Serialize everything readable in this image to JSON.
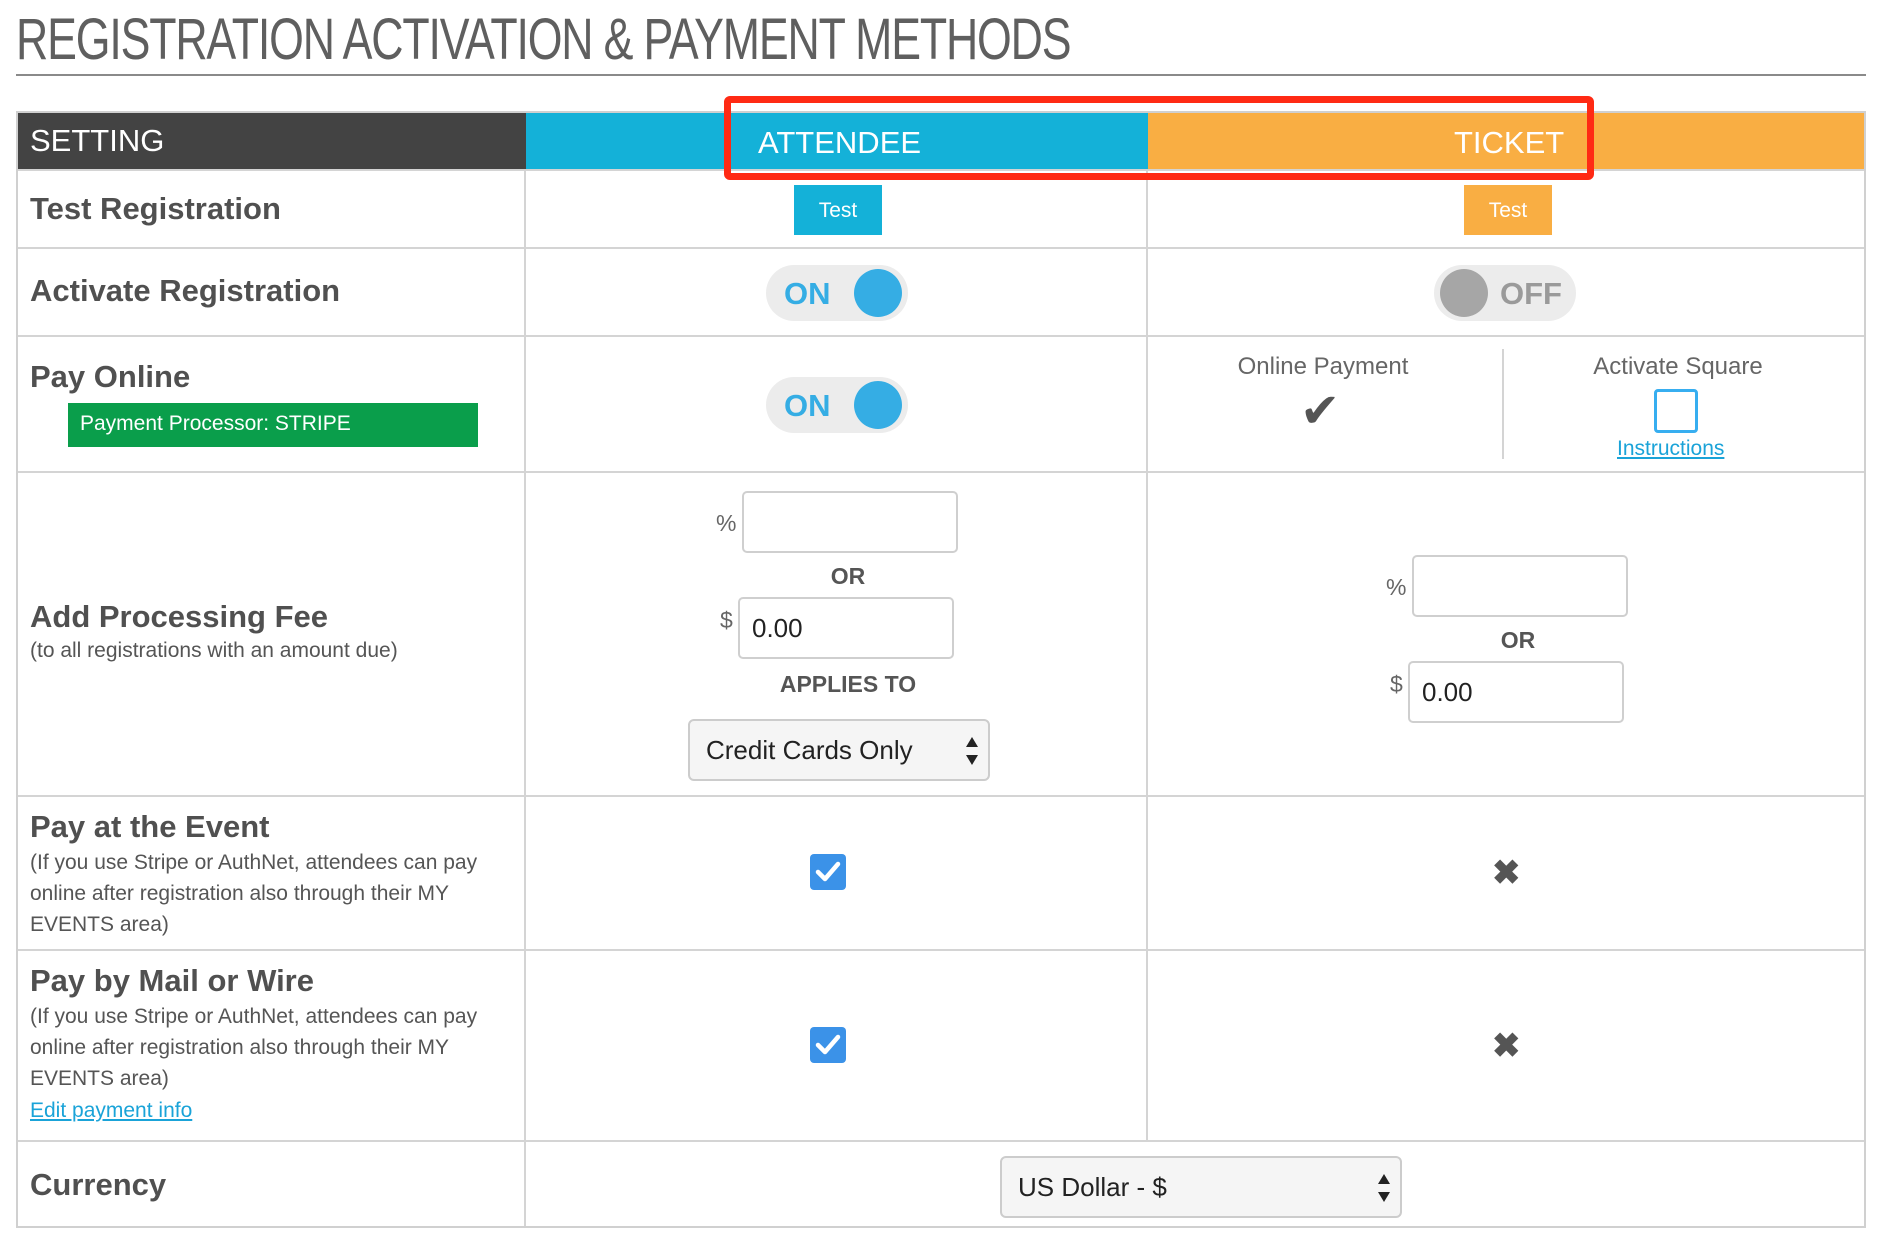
{
  "page": {
    "title": "REGISTRATION ACTIVATION & PAYMENT METHODS"
  },
  "colors": {
    "attendee": "#14b1d8",
    "ticket": "#f9ae43",
    "header_dark": "#434343",
    "highlight": "#ff2a14",
    "stripe_badge": "#0a9e4b",
    "toggle_on": "#35ade4",
    "link": "#1aa3d8"
  },
  "header": {
    "setting": "SETTING",
    "attendee": "ATTENDEE",
    "ticket": "TICKET"
  },
  "rows": {
    "test_registration": {
      "label": "Test Registration",
      "attendee_button": "Test",
      "ticket_button": "Test"
    },
    "activate_registration": {
      "label": "Activate Registration",
      "attendee_toggle": "ON",
      "ticket_toggle": "OFF"
    },
    "pay_online": {
      "label": "Pay Online",
      "processor_badge": "Payment Processor: STRIPE",
      "attendee_toggle": "ON",
      "online_payment_label": "Online Payment",
      "online_payment_icon": "check-icon",
      "activate_square_label": "Activate Square",
      "instructions_link": "Instructions"
    },
    "processing_fee": {
      "label": "Add Processing Fee",
      "sublabel": "(to all registrations with an amount due)",
      "percent_symbol": "%",
      "dollar_symbol": "$",
      "or_text": "OR",
      "attendee_percent": "",
      "attendee_amount": "0.00",
      "applies_to_label": "APPLIES TO",
      "applies_to_value": "Credit Cards Only",
      "ticket_percent": "",
      "ticket_amount": "0.00"
    },
    "pay_at_event": {
      "label": "Pay at the Event",
      "sublabel": "(If you use Stripe or AuthNet, attendees can pay online after registration also through their MY EVENTS area)",
      "attendee_checked": true,
      "ticket_icon": "x-icon"
    },
    "pay_by_mail": {
      "label": "Pay by Mail or Wire",
      "sublabel": "(If you use Stripe or AuthNet, attendees can pay online after registration also through their MY EVENTS area)",
      "edit_link": "Edit payment info",
      "attendee_checked": true,
      "ticket_icon": "x-icon"
    },
    "currency": {
      "label": "Currency",
      "value": "US Dollar - $"
    }
  }
}
